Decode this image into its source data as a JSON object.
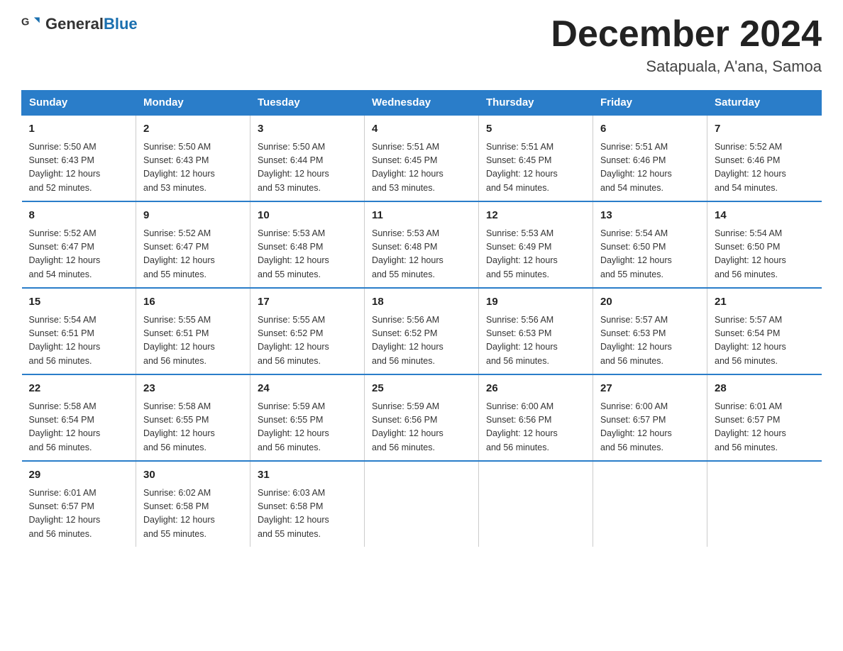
{
  "header": {
    "logo_general": "General",
    "logo_blue": "Blue",
    "month_title": "December 2024",
    "location": "Satapuala, A'ana, Samoa"
  },
  "weekdays": [
    "Sunday",
    "Monday",
    "Tuesday",
    "Wednesday",
    "Thursday",
    "Friday",
    "Saturday"
  ],
  "weeks": [
    [
      {
        "day": "1",
        "sunrise": "5:50 AM",
        "sunset": "6:43 PM",
        "daylight": "12 hours and 52 minutes."
      },
      {
        "day": "2",
        "sunrise": "5:50 AM",
        "sunset": "6:43 PM",
        "daylight": "12 hours and 53 minutes."
      },
      {
        "day": "3",
        "sunrise": "5:50 AM",
        "sunset": "6:44 PM",
        "daylight": "12 hours and 53 minutes."
      },
      {
        "day": "4",
        "sunrise": "5:51 AM",
        "sunset": "6:45 PM",
        "daylight": "12 hours and 53 minutes."
      },
      {
        "day": "5",
        "sunrise": "5:51 AM",
        "sunset": "6:45 PM",
        "daylight": "12 hours and 54 minutes."
      },
      {
        "day": "6",
        "sunrise": "5:51 AM",
        "sunset": "6:46 PM",
        "daylight": "12 hours and 54 minutes."
      },
      {
        "day": "7",
        "sunrise": "5:52 AM",
        "sunset": "6:46 PM",
        "daylight": "12 hours and 54 minutes."
      }
    ],
    [
      {
        "day": "8",
        "sunrise": "5:52 AM",
        "sunset": "6:47 PM",
        "daylight": "12 hours and 54 minutes."
      },
      {
        "day": "9",
        "sunrise": "5:52 AM",
        "sunset": "6:47 PM",
        "daylight": "12 hours and 55 minutes."
      },
      {
        "day": "10",
        "sunrise": "5:53 AM",
        "sunset": "6:48 PM",
        "daylight": "12 hours and 55 minutes."
      },
      {
        "day": "11",
        "sunrise": "5:53 AM",
        "sunset": "6:48 PM",
        "daylight": "12 hours and 55 minutes."
      },
      {
        "day": "12",
        "sunrise": "5:53 AM",
        "sunset": "6:49 PM",
        "daylight": "12 hours and 55 minutes."
      },
      {
        "day": "13",
        "sunrise": "5:54 AM",
        "sunset": "6:50 PM",
        "daylight": "12 hours and 55 minutes."
      },
      {
        "day": "14",
        "sunrise": "5:54 AM",
        "sunset": "6:50 PM",
        "daylight": "12 hours and 56 minutes."
      }
    ],
    [
      {
        "day": "15",
        "sunrise": "5:54 AM",
        "sunset": "6:51 PM",
        "daylight": "12 hours and 56 minutes."
      },
      {
        "day": "16",
        "sunrise": "5:55 AM",
        "sunset": "6:51 PM",
        "daylight": "12 hours and 56 minutes."
      },
      {
        "day": "17",
        "sunrise": "5:55 AM",
        "sunset": "6:52 PM",
        "daylight": "12 hours and 56 minutes."
      },
      {
        "day": "18",
        "sunrise": "5:56 AM",
        "sunset": "6:52 PM",
        "daylight": "12 hours and 56 minutes."
      },
      {
        "day": "19",
        "sunrise": "5:56 AM",
        "sunset": "6:53 PM",
        "daylight": "12 hours and 56 minutes."
      },
      {
        "day": "20",
        "sunrise": "5:57 AM",
        "sunset": "6:53 PM",
        "daylight": "12 hours and 56 minutes."
      },
      {
        "day": "21",
        "sunrise": "5:57 AM",
        "sunset": "6:54 PM",
        "daylight": "12 hours and 56 minutes."
      }
    ],
    [
      {
        "day": "22",
        "sunrise": "5:58 AM",
        "sunset": "6:54 PM",
        "daylight": "12 hours and 56 minutes."
      },
      {
        "day": "23",
        "sunrise": "5:58 AM",
        "sunset": "6:55 PM",
        "daylight": "12 hours and 56 minutes."
      },
      {
        "day": "24",
        "sunrise": "5:59 AM",
        "sunset": "6:55 PM",
        "daylight": "12 hours and 56 minutes."
      },
      {
        "day": "25",
        "sunrise": "5:59 AM",
        "sunset": "6:56 PM",
        "daylight": "12 hours and 56 minutes."
      },
      {
        "day": "26",
        "sunrise": "6:00 AM",
        "sunset": "6:56 PM",
        "daylight": "12 hours and 56 minutes."
      },
      {
        "day": "27",
        "sunrise": "6:00 AM",
        "sunset": "6:57 PM",
        "daylight": "12 hours and 56 minutes."
      },
      {
        "day": "28",
        "sunrise": "6:01 AM",
        "sunset": "6:57 PM",
        "daylight": "12 hours and 56 minutes."
      }
    ],
    [
      {
        "day": "29",
        "sunrise": "6:01 AM",
        "sunset": "6:57 PM",
        "daylight": "12 hours and 56 minutes."
      },
      {
        "day": "30",
        "sunrise": "6:02 AM",
        "sunset": "6:58 PM",
        "daylight": "12 hours and 55 minutes."
      },
      {
        "day": "31",
        "sunrise": "6:03 AM",
        "sunset": "6:58 PM",
        "daylight": "12 hours and 55 minutes."
      },
      null,
      null,
      null,
      null
    ]
  ]
}
